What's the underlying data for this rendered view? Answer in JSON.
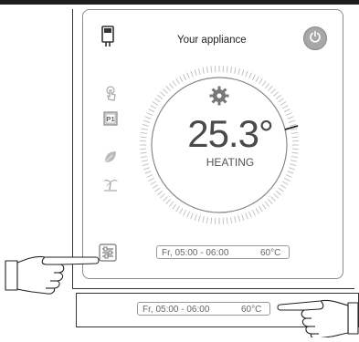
{
  "app": {
    "title": "Your appliance"
  },
  "status": {
    "temperature": "25.3°",
    "mode": "HEATING"
  },
  "schedule": {
    "time": "Fr, 05:00 - 06:00",
    "temperature": "60°C"
  },
  "zoomed_schedule": {
    "time": "Fr, 05:00 - 06:00",
    "temperature": "60°C"
  },
  "icons": {
    "sidebar": [
      "device-icon",
      "touch-icon",
      "p1-icon",
      "leaf-icon",
      "palm-tree-icon",
      "settings-sliders-icon"
    ],
    "power": "power-icon",
    "heating": "gear-icon"
  },
  "colors": {
    "power_button": "#a7a7a7",
    "dial_tick": "#222222",
    "frame": "#1e1e1e"
  }
}
